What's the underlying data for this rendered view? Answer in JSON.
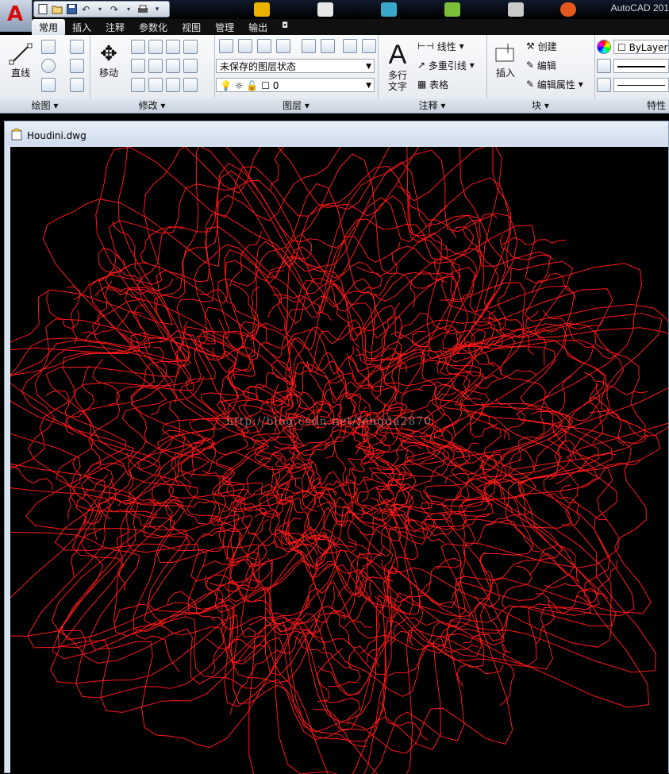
{
  "app": {
    "title": "AutoCAD 201",
    "logo_letter": "A"
  },
  "quick_access": {
    "icons": [
      "new-icon",
      "open-icon",
      "save-icon",
      "undo-icon",
      "redo-icon",
      "plot-icon"
    ]
  },
  "tabs": [
    {
      "label": "常用",
      "active": true
    },
    {
      "label": "插入",
      "active": false
    },
    {
      "label": "注释",
      "active": false
    },
    {
      "label": "参数化",
      "active": false
    },
    {
      "label": "视图",
      "active": false
    },
    {
      "label": "管理",
      "active": false
    },
    {
      "label": "输出",
      "active": false
    }
  ],
  "ribbon": {
    "draw": {
      "line_label": "直线",
      "title": "绘图"
    },
    "modify": {
      "move_label": "移动",
      "title": "修改"
    },
    "layers": {
      "state_value": "未保存的图层状态",
      "layer_value": "0",
      "title": "图层"
    },
    "annotation": {
      "mtext_label_1": "多行",
      "mtext_label_2": "文字",
      "linear_label": "线性",
      "multileader_label": "多重引线",
      "table_label": "表格",
      "title": "注释"
    },
    "block": {
      "insert_label": "插入",
      "create_label": "创建",
      "edit_label": "编辑",
      "edit_attr_label": "编辑属性",
      "title": "块"
    },
    "properties": {
      "color_value": "ByLayer",
      "title": "特性"
    }
  },
  "document": {
    "filename": "Houdini.dwg",
    "watermark": "http://blog.csdn.net/fengda2870"
  },
  "colors": {
    "drawing_line": "#ff1a1a",
    "canvas_bg": "#000000"
  }
}
